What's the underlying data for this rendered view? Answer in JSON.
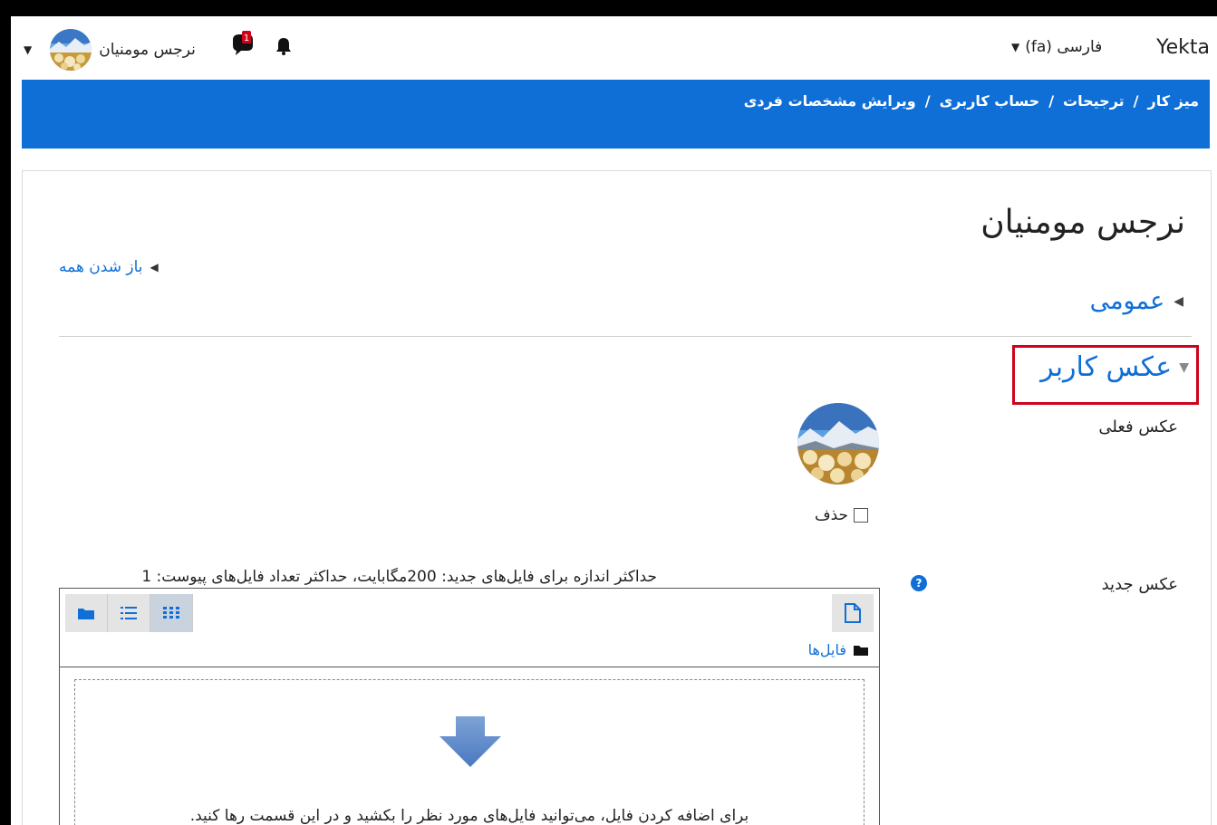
{
  "navbar": {
    "brand": "Yekta",
    "language": "فارسی (fa)",
    "user_name": "نرجس مومنیان",
    "message_badge": "1"
  },
  "breadcrumb": {
    "items": [
      "میز کار",
      "ترجیحات",
      "حساب کاربری",
      "ویرایش مشخصات فردی"
    ],
    "separator": "/"
  },
  "page": {
    "title": "نرجس مومنیان",
    "expand_all": "باز شدن همه",
    "section_general": "عمومی",
    "section_user_picture": "عکس کاربر",
    "current_picture_label": "عکس فعلی",
    "delete_label": "حذف",
    "new_picture_label": "عکس جدید",
    "file_limits": "حداکثر اندازه برای فایل‌های جدید: 200مگابایت، حداکثر تعداد فایل‌های پیوست: 1",
    "files_path": "فایل‌ها",
    "drop_text": "برای اضافه کردن فایل، می‌توانید فایل‌های مورد نظر را بکشید و در این قسمت رها کنید."
  },
  "colors": {
    "accent": "#0f6fd6",
    "highlight_border": "#d0021b"
  },
  "icons": [
    "caret-down-icon",
    "bell-icon",
    "message-icon",
    "help-icon",
    "add-file-icon",
    "folder-icon",
    "list-view-icon",
    "grid-view-icon",
    "down-arrow-icon"
  ]
}
